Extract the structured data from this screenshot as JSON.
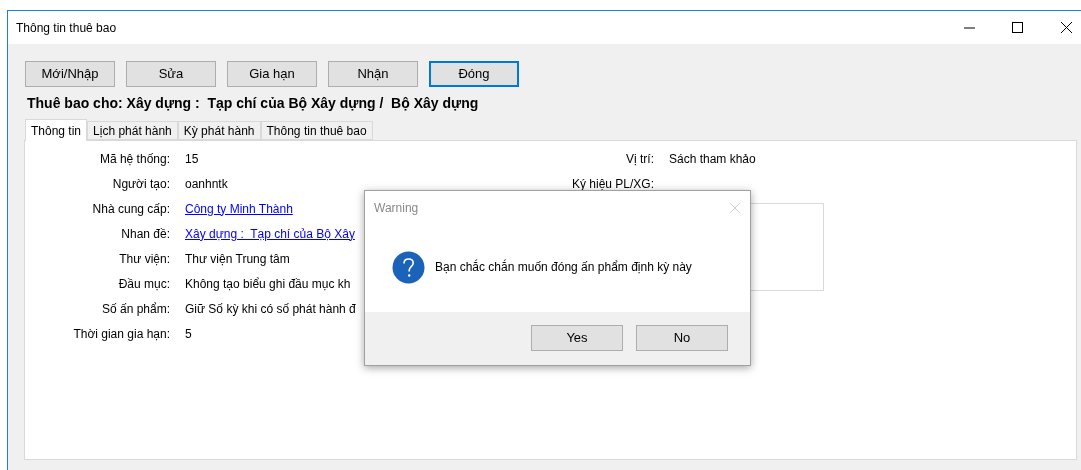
{
  "window": {
    "title": "Thông tin thuê bao"
  },
  "toolbar": [
    {
      "label": "Mới/Nhập",
      "focused": false
    },
    {
      "label": "Sửa",
      "focused": false
    },
    {
      "label": "Gia hạn",
      "focused": false
    },
    {
      "label": "Nhận",
      "focused": false
    },
    {
      "label": "Đóng",
      "focused": true
    }
  ],
  "heading": "Thuê bao cho: Xây dựng :  Tạp chí của Bộ Xây dựng /  Bộ Xây dựng",
  "tabs": [
    {
      "label": "Thông tin",
      "selected": true
    },
    {
      "label": "Lịch phát hành",
      "selected": false
    },
    {
      "label": "Kỳ phát hành",
      "selected": false
    },
    {
      "label": "Thông tin thuê bao",
      "selected": false
    }
  ],
  "fields_left": [
    {
      "label": "Mã hệ thống:",
      "value": "15",
      "kind": "text"
    },
    {
      "label": "Người tạo:",
      "value": "oanhntk",
      "kind": "text"
    },
    {
      "label": "Nhà cung cấp:",
      "value": "Công ty Minh Thành",
      "kind": "link"
    },
    {
      "label": "Nhan đề:",
      "value": "Xây dựng :  Tạp chí của Bộ Xây",
      "kind": "link"
    },
    {
      "label": "Thư viện:",
      "value": "Thư viện Trung tâm",
      "kind": "text"
    },
    {
      "label": "Đầu mục:",
      "value": "Không tạo biểu ghi đầu mục kh",
      "kind": "text"
    },
    {
      "label": "Số ấn phẩm:",
      "value": "Giữ Số kỳ khi có số phát hành đ",
      "kind": "text"
    },
    {
      "label": "Thời gian gia hạn:",
      "value": "5",
      "kind": "text"
    }
  ],
  "fields_right": [
    {
      "label": "Vị trí:",
      "value": "Sách tham khảo"
    },
    {
      "label": "Ký hiệu PL/XG:"
    }
  ],
  "dialog": {
    "title": "Warning",
    "message": "Bạn chắc chắn muốn đóng ấn phẩm định kỳ này",
    "buttons": [
      {
        "label": "Yes"
      },
      {
        "label": "No"
      }
    ]
  }
}
